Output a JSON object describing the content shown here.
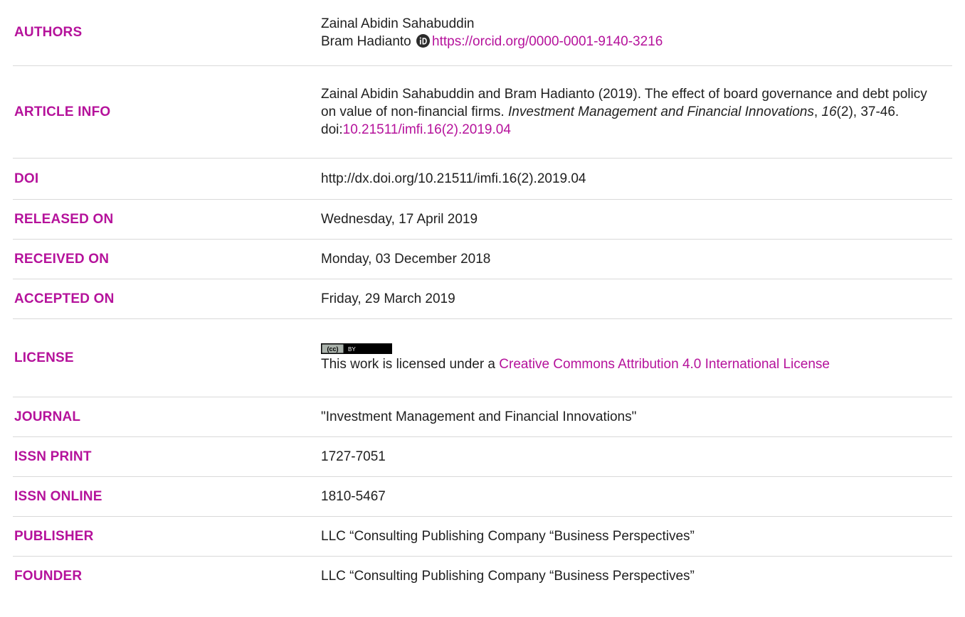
{
  "rows": {
    "authors": {
      "label": "AUTHORS",
      "author1": "Zainal Abidin Sahabuddin",
      "author2": "Bram Hadianto",
      "orcid_icon": "orcid-icon",
      "orcid_url": "https://orcid.org/0000-0001-9140-3216"
    },
    "article_info": {
      "label": "ARTICLE INFO",
      "citation_pre": "Zainal Abidin Sahabuddin and Bram Hadianto (2019). The effect of board governance and debt policy on value of non-financial firms. ",
      "journal_italic": "Investment Management and Financial Innovations",
      "comma1": ", ",
      "volume_italic": "16",
      "issue_pages": "(2), 37-46.",
      "doi_prefix": "doi:",
      "doi_link": "10.21511/imfi.16(2).2019.04"
    },
    "doi": {
      "label": "DOI",
      "value": "http://dx.doi.org/10.21511/imfi.16(2).2019.04"
    },
    "released_on": {
      "label": "RELEASED ON",
      "value": "Wednesday, 17 April 2019"
    },
    "received_on": {
      "label": "RECEIVED ON",
      "value": "Monday, 03 December 2018"
    },
    "accepted_on": {
      "label": "ACCEPTED ON",
      "value": "Friday, 29 March 2019"
    },
    "license": {
      "label": "LICENSE",
      "badge_icon": "cc-by-badge",
      "badge_text_cc": "(cc)",
      "badge_text_by": "BY",
      "text_pre": "This work is licensed under a ",
      "link": "Creative Commons Attribution 4.0 International License"
    },
    "journal": {
      "label": "JOURNAL",
      "value": "\"Investment Management and Financial Innovations\""
    },
    "issn_print": {
      "label": "ISSN PRINT",
      "value": "1727-7051"
    },
    "issn_online": {
      "label": "ISSN ONLINE",
      "value": "1810-5467"
    },
    "publisher": {
      "label": "PUBLISHER",
      "value": "LLC “Consulting Publishing Company “Business Perspectives”"
    },
    "founder": {
      "label": "FOUNDER",
      "value": "LLC “Consulting Publishing Company “Business Perspectives”"
    }
  },
  "colors": {
    "label": "#b5129b",
    "link": "#b5129b",
    "text": "#1f1f1f",
    "rule": "#d9d9d9"
  }
}
